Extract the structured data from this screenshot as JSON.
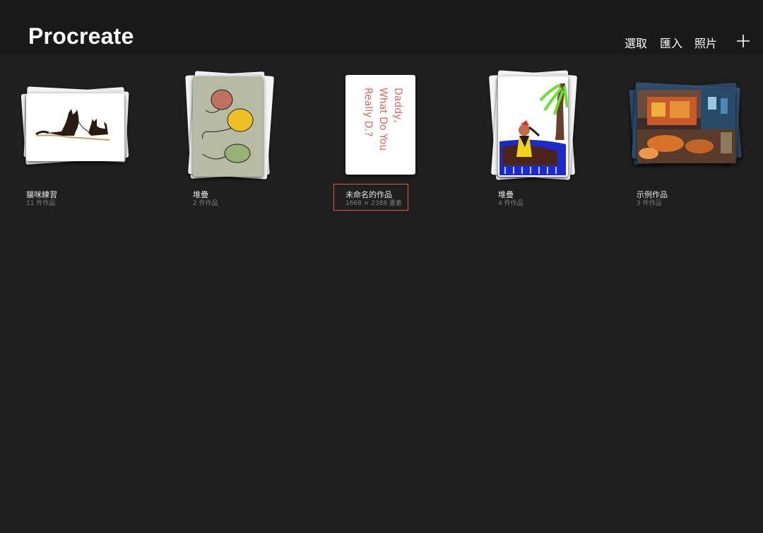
{
  "header": {
    "title": "Procreate",
    "buttons": {
      "select": "選取",
      "import": "匯入",
      "photos": "照片"
    },
    "add_icon": "plus-icon"
  },
  "gallery": {
    "items": [
      {
        "title": "貓咪練習",
        "subtitle": "11 件作品",
        "kind": "stack"
      },
      {
        "title": "堆疊",
        "subtitle": "2 件作品",
        "kind": "stack"
      },
      {
        "title": "未命名的作品",
        "subtitle": "1668 × 2388 畫素",
        "kind": "artwork",
        "selected": true,
        "note_text": [
          "Daddy,",
          "What Do You",
          "Really D.?"
        ]
      },
      {
        "title": "堆疊",
        "subtitle": "4 件作品",
        "kind": "stack"
      },
      {
        "title": "示例作品",
        "subtitle": "3 件作品",
        "kind": "stack"
      }
    ]
  },
  "colors": {
    "background": "#1f1f1f",
    "header": "#191919",
    "selection": "#e2574c"
  }
}
